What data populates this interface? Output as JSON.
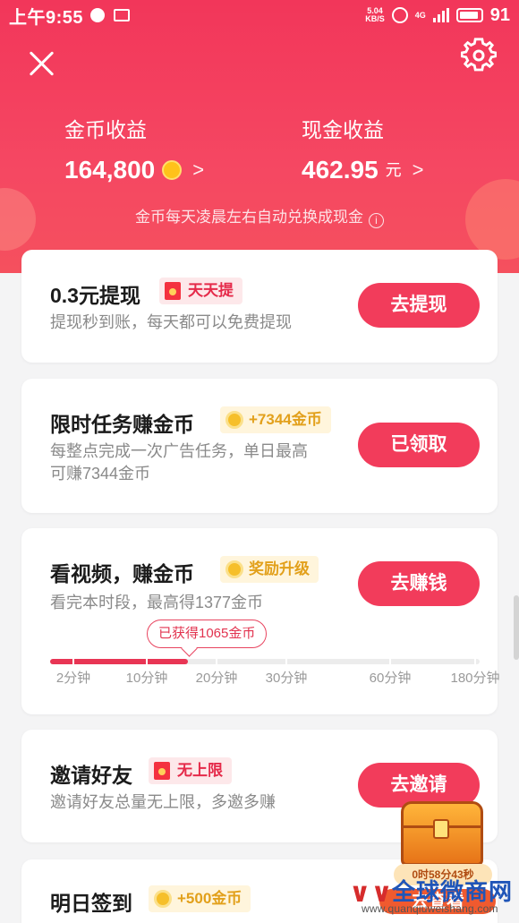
{
  "status_bar": {
    "time": "上午9:55",
    "speed_value": "5.04",
    "speed_unit": "KB/S",
    "network": "4G",
    "battery": "91"
  },
  "header": {
    "close_icon": "close-icon",
    "settings_icon": "gear-icon"
  },
  "earnings": {
    "coins": {
      "label": "金币收益",
      "value": "164,800",
      "chevron": ">"
    },
    "cash": {
      "label": "现金收益",
      "value": "462.95",
      "unit": "元",
      "chevron": ">"
    },
    "note": "金币每天凌晨左右自动兑换成现金"
  },
  "cards": {
    "withdraw": {
      "title": "0.3元提现",
      "tag": "天天提",
      "subtitle": "提现秒到账，每天都可以免费提现",
      "button": "去提现"
    },
    "limited": {
      "title": "限时任务赚金币",
      "tag": "+7344金币",
      "subtitle_line1": "每整点完成一次广告任务，单日最高",
      "subtitle_line2": "可赚7344金币",
      "button": "已领取"
    },
    "video": {
      "title": "看视频，赚金币",
      "tag": "奖励升级",
      "subtitle": "看完本时段，最高得1377金币",
      "button": "去赚钱",
      "bubble": "已获得1065金币",
      "progress_fraction": 0.32,
      "ticks": [
        "2分钟",
        "10分钟",
        "20分钟",
        "30分钟",
        "60分钟",
        "180分钟"
      ]
    },
    "invite": {
      "title": "邀请好友",
      "tag": "无上限",
      "subtitle": "邀请好友总量无上限，多邀多赚",
      "button": "去邀请"
    },
    "checkin": {
      "title": "明日签到",
      "tag": "+500金币"
    }
  },
  "chest": {
    "timer": "0时58分43秒",
    "button": "去查看"
  },
  "watermark": {
    "brand": "全球微商网",
    "url": "www.quanqiuweishang.com"
  },
  "colors": {
    "primary": "#f23c5b",
    "gold": "#e2a01b"
  }
}
